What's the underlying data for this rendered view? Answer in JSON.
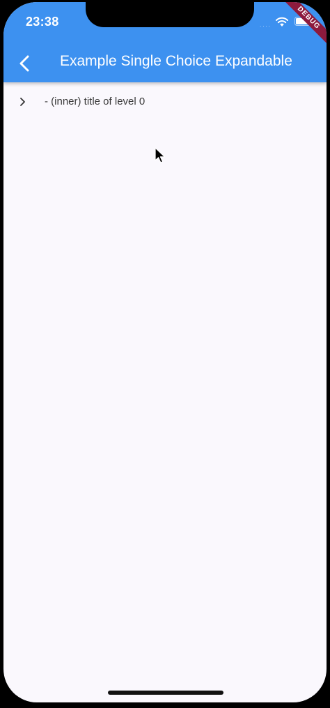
{
  "status_bar": {
    "time": "23:38",
    "signal_dots": "....",
    "icons": [
      "wifi-icon",
      "battery-icon"
    ]
  },
  "debug_banner": {
    "label": "DEBUG"
  },
  "app_bar": {
    "back_icon": "chevron-left-icon",
    "title": "Example Single Choice Expandable"
  },
  "list": {
    "items": [
      {
        "icon": "chevron-right-icon",
        "label": "- (inner) title of level 0"
      }
    ]
  },
  "colors": {
    "app_bar": "#3d91f0",
    "background": "#faf8fd",
    "debug_ribbon": "#8d1a3d",
    "text": "#3a3a3a"
  }
}
